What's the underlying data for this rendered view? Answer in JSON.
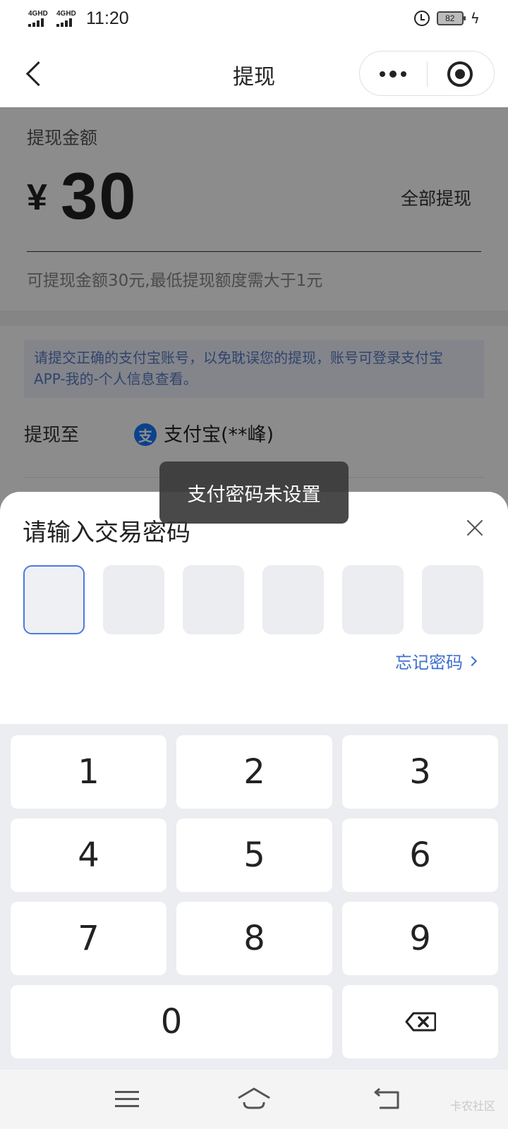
{
  "status_bar": {
    "network_1": "4GHD",
    "network_2": "4GHD",
    "time": "11:20",
    "battery": "82"
  },
  "nav": {
    "title": "提现"
  },
  "withdraw": {
    "amount_label": "提现金额",
    "currency_symbol": "¥",
    "amount": "30",
    "withdraw_all": "全部提现",
    "hint": "可提现金额30元,最低提现额度需大于1元",
    "notice": "请提交正确的支付宝账号，以免耽误您的提现，账号可登录支付宝APP-我的-个人信息查看。",
    "to_label": "提现至",
    "alipay_icon_char": "支",
    "to_account": "支付宝(**峰)"
  },
  "toast": {
    "message": "支付密码未设置"
  },
  "password_sheet": {
    "title": "请输入交易密码",
    "forgot_label": "忘记密码",
    "pin_length": 6
  },
  "keypad": {
    "keys": [
      "1",
      "2",
      "3",
      "4",
      "5",
      "6",
      "7",
      "8",
      "9",
      "0"
    ]
  },
  "watermark": "卡农社区",
  "colors": {
    "accent_blue": "#3d6fd1",
    "alipay_blue": "#1677ff",
    "overlay": "rgba(0,0,0,0.45)"
  }
}
